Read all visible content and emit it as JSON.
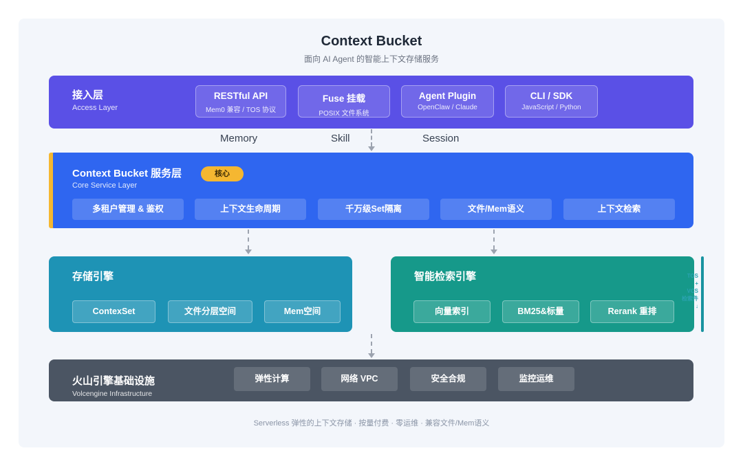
{
  "header": {
    "title": "Context Bucket",
    "subtitle": "面向 AI Agent 的智能上下文存储服务"
  },
  "access_layer": {
    "title": "接入层",
    "subtitle": "Access Layer",
    "items": [
      {
        "title": "RESTful API",
        "sub": "Mem0 兼容 / TOS 协议"
      },
      {
        "title": "Fuse 挂载",
        "sub": "POSIX 文件系统"
      },
      {
        "title": "Agent Plugin",
        "sub": "OpenClaw / Claude"
      },
      {
        "title": "CLI / SDK",
        "sub": "JavaScript / Python"
      }
    ]
  },
  "flows": [
    "Memory",
    "Skill",
    "Session"
  ],
  "service_layer": {
    "title": "Context Bucket 服务层",
    "subtitle": "Core Service Layer",
    "badge": "核心",
    "items": [
      "多租户管理 & 鉴权",
      "上下文生命周期",
      "千万级Set隔离",
      "文件/Mem语义",
      "上下文检索"
    ]
  },
  "storage_engine": {
    "title": "存储引擎",
    "items": [
      "ContexSet",
      "文件分层空间",
      "Mem空间"
    ]
  },
  "search_engine": {
    "title": "智能检索引擎",
    "items": [
      "向量索引",
      "BM25&标量",
      "Rerank 重排"
    ]
  },
  "side_labels": [
    "TOS",
    "+",
    "VCS",
    "检索件",
    "↓"
  ],
  "infra_layer": {
    "title": "火山引擎基础设施",
    "subtitle": "Volcengine Infrastructure",
    "items": [
      "弹性计算",
      "网络 VPC",
      "安全合规",
      "监控运维"
    ]
  },
  "footer": "Serverless 弹性的上下文存储 · 按量付费 · 零运维 · 兼容文件/Mem语义",
  "colors": {
    "access": "#5a50e6",
    "service": "#2f66f0",
    "accent": "#f5b731",
    "storage": "#1e93b5",
    "search": "#16998a",
    "infra": "#4b5563"
  }
}
